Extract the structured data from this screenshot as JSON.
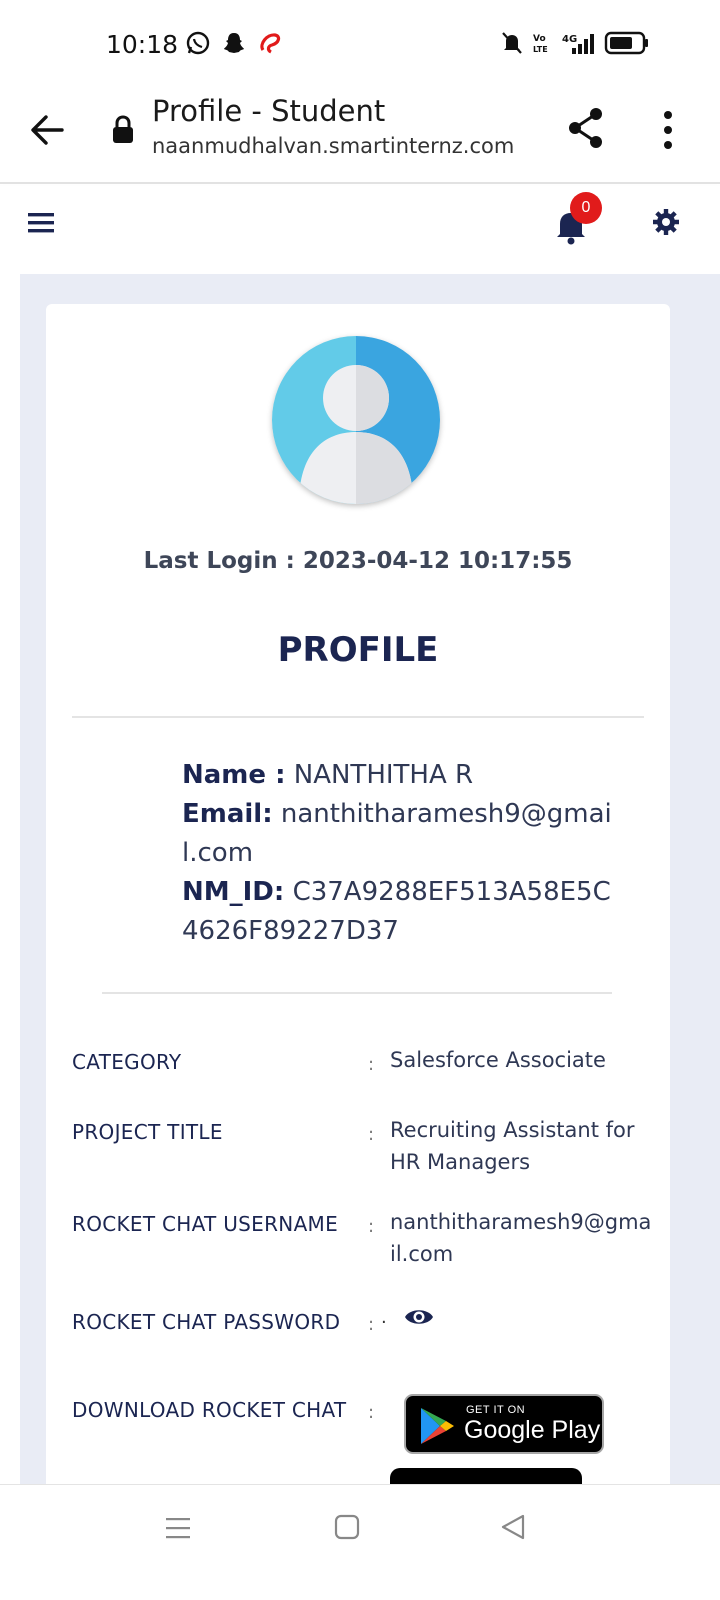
{
  "status_bar": {
    "time": "10:18",
    "app_icons": [
      "whatsapp-icon",
      "snapchat-icon",
      "airtel-icon"
    ],
    "right_icons": [
      "mute-icon",
      "volte-icon",
      "4g-signal-icon",
      "battery-icon"
    ],
    "network": "4G"
  },
  "browser": {
    "title": "Profile - Student",
    "url": "naanmudhalvan.smartinternz.com"
  },
  "app_header": {
    "notification_count": "0"
  },
  "profile": {
    "last_login": "Last Login : 2023-04-12 10:17:55",
    "heading": "PROFILE",
    "name_label": "Name :",
    "name_value": "NANTHITHA R",
    "email_label": "Email:",
    "email_value": "nanthitharamesh9@gmail.com",
    "nmid_label": "NM_ID:",
    "nmid_value": "C37A9288EF513A58E5C4626F89227D37"
  },
  "details": [
    {
      "label": "CATEGORY",
      "value": "Salesforce Associate"
    },
    {
      "label": "PROJECT TITLE",
      "value": "Recruiting Assistant for HR Managers"
    },
    {
      "label": "ROCKET CHAT USERNAME",
      "value": "nanthitharamesh9@gmail.com"
    },
    {
      "label": "ROCKET CHAT PASSWORD",
      "value": "·"
    },
    {
      "label": "DOWNLOAD ROCKET CHAT",
      "value": ""
    }
  ],
  "colon": ":",
  "google_play": {
    "small": "GET IT ON",
    "big": "Google Play"
  },
  "colors": {
    "accent": "#1b2551",
    "badge": "#e11b1b",
    "background": "#e9ecf5"
  }
}
